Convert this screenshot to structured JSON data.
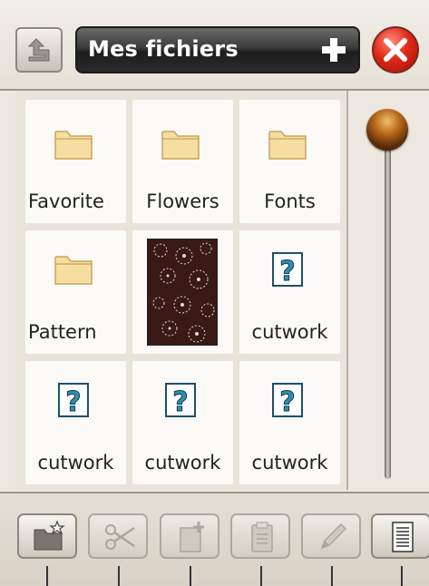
{
  "header": {
    "title": "Mes fichiers"
  },
  "tiles": [
    {
      "label": "Favorite",
      "type": "folder"
    },
    {
      "label": "Flowers",
      "type": "folder"
    },
    {
      "label": "Fonts",
      "type": "folder"
    },
    {
      "label": "Pattern",
      "type": "folder"
    },
    {
      "label": "",
      "type": "thumbnail"
    },
    {
      "label": "cutwork",
      "type": "unknown-file"
    },
    {
      "label": "cutwork",
      "type": "unknown-file"
    },
    {
      "label": "cutwork",
      "type": "unknown-file"
    },
    {
      "label": "cutwork",
      "type": "unknown-file"
    }
  ],
  "toolbar": {
    "buttons": [
      {
        "icon": "new-folder-icon",
        "enabled": true
      },
      {
        "icon": "scissors-icon",
        "enabled": false
      },
      {
        "icon": "copy-icon",
        "enabled": false
      },
      {
        "icon": "paste-icon",
        "enabled": false
      },
      {
        "icon": "pencil-icon",
        "enabled": false
      },
      {
        "icon": "list-view-icon",
        "enabled": true
      }
    ]
  },
  "colors": {
    "title_bar": "#2a2a2a",
    "close_button": "#e02a18",
    "folder": "#f5dea0",
    "scroll_thumb": "#b86a1a"
  }
}
